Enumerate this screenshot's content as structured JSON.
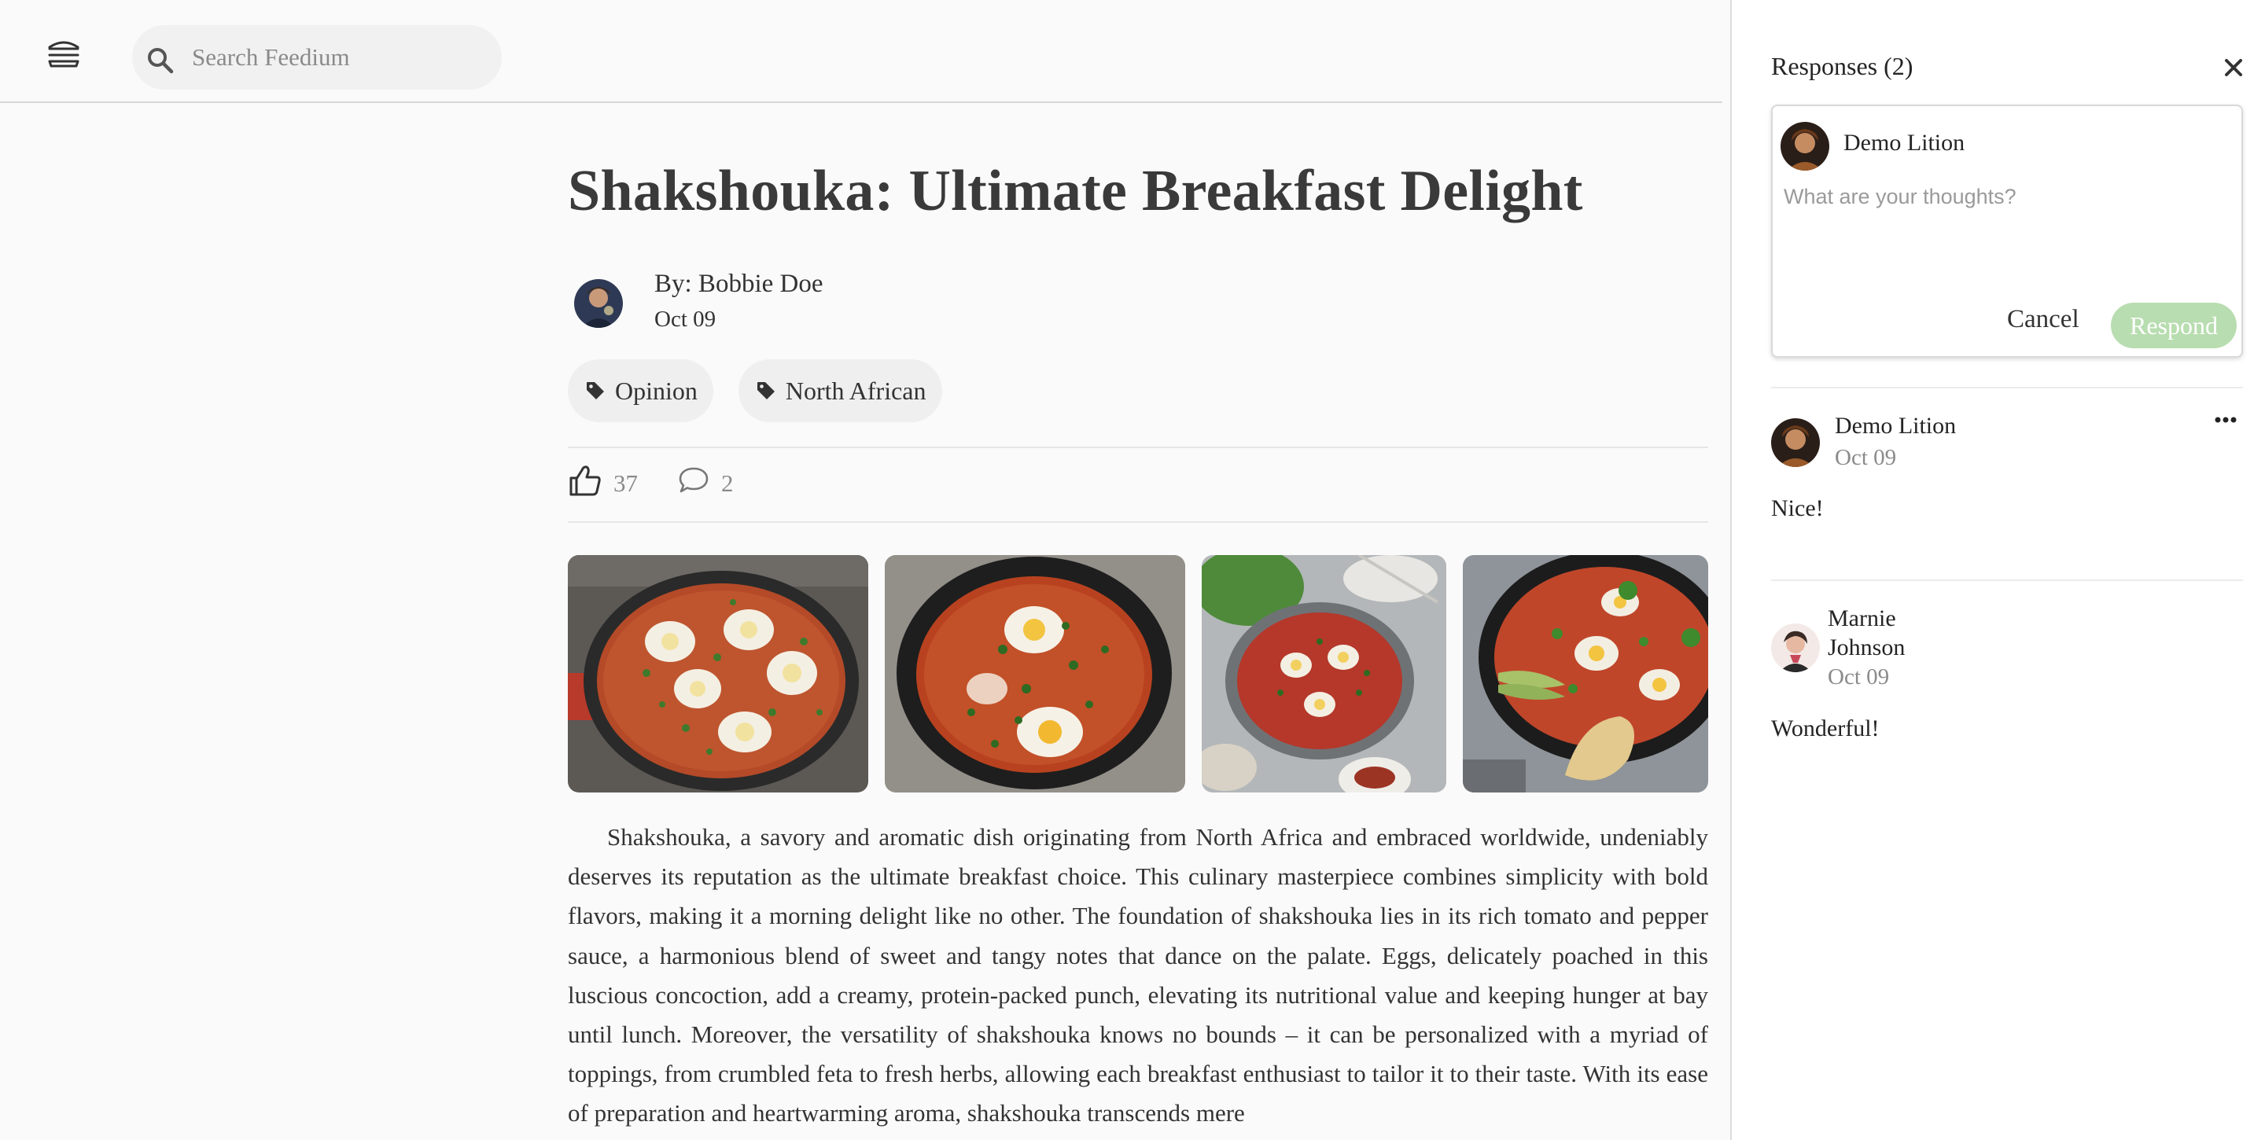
{
  "header": {
    "menu_icon": "burger-menu-icon",
    "search": {
      "icon": "search-icon",
      "placeholder": "Search Feedium",
      "value": ""
    }
  },
  "article": {
    "title": "Shakshouka: Ultimate Breakfast Delight",
    "author": "By: Bobbie Doe",
    "date": "Oct 09",
    "tags": [
      {
        "icon": "tag-icon",
        "label": "Opinion"
      },
      {
        "icon": "tag-icon",
        "label": "North African"
      }
    ],
    "stats": {
      "likes": "37",
      "comments": "2"
    },
    "images": [
      "shakshouka-skillet-photo",
      "shakshouka-cast-iron-photo",
      "shakshouka-pan-photo",
      "shakshouka-avocado-photo"
    ],
    "body": "Shakshouka, a savory and aromatic dish originating from North Africa and embraced worldwide, undeniably deserves its reputation as the ultimate breakfast choice. This culinary masterpiece combines simplicity with bold flavors, making it a morning delight like no other. The foundation of shakshouka lies in its rich tomato and pepper sauce, a harmonious blend of sweet and tangy notes that dance on the palate. Eggs, delicately poached in this luscious concoction, add a creamy, protein-packed punch, elevating its nutritional value and keeping hunger at bay until lunch. Moreover, the versatility of shakshouka knows no bounds – it can be personalized with a myriad of toppings, from crumbled feta to fresh herbs, allowing each breakfast enthusiast to tailor it to their taste. With its ease of preparation and heartwarming aroma, shakshouka transcends mere"
  },
  "responses_panel": {
    "title": "Responses (2)",
    "close_icon": "close-icon",
    "compose": {
      "user": "Demo Lition",
      "placeholder": "What are your thoughts?",
      "cancel_label": "Cancel",
      "respond_label": "Respond"
    },
    "responses": [
      {
        "name": "Demo Lition",
        "date": "Oct 09",
        "text": "Nice!"
      },
      {
        "name_line1": "Marnie",
        "name_line2": "Johnson",
        "date": "Oct 09",
        "text": "Wonderful!"
      }
    ],
    "more_icon": "more-options-icon"
  },
  "colors": {
    "background": "#fafafa",
    "panel": "#ffffff",
    "respond_button": "#b8ddb0",
    "tag_background": "#efefef"
  }
}
